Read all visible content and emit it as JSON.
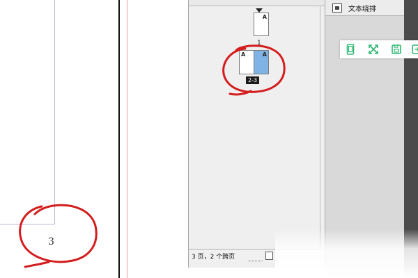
{
  "document": {
    "page_number": "3"
  },
  "pages_panel": {
    "page1_label": "1",
    "spread_label": "2-3",
    "master_prefix": "A",
    "status_text": "3 页，2 个跨页"
  },
  "right_panel": {
    "text_wrap_label": "文本绕排"
  },
  "floating_toolbar": {
    "icons": [
      "mobile-icon",
      "fullscreen-icon",
      "save-icon",
      "export-icon"
    ],
    "accent_color": "#2eb872"
  },
  "annotation_color": "#d41c1c"
}
